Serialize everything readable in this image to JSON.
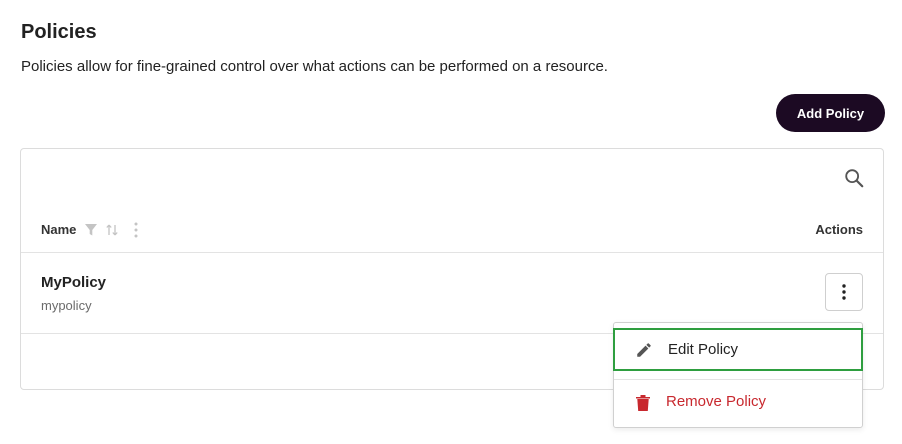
{
  "header": {
    "title": "Policies",
    "description": "Policies allow for fine-grained control over what actions can be performed on a resource.",
    "add_label": "Add Policy"
  },
  "table": {
    "columns": {
      "name": "Name",
      "actions": "Actions"
    },
    "rows": [
      {
        "name": "MyPolicy",
        "id": "mypolicy"
      }
    ]
  },
  "menu": {
    "edit_label": "Edit Policy",
    "remove_label": "Remove Policy"
  },
  "icons": {
    "search": "search-icon",
    "filter": "filter-icon",
    "sort": "sort-icon",
    "column_menu": "kebab-icon",
    "row_actions": "kebab-icon",
    "edit": "pencil-icon",
    "remove": "trash-icon"
  },
  "colors": {
    "primary_button": "#1c0a23",
    "danger": "#c8282e",
    "focus_outline": "#2e9e3f"
  }
}
